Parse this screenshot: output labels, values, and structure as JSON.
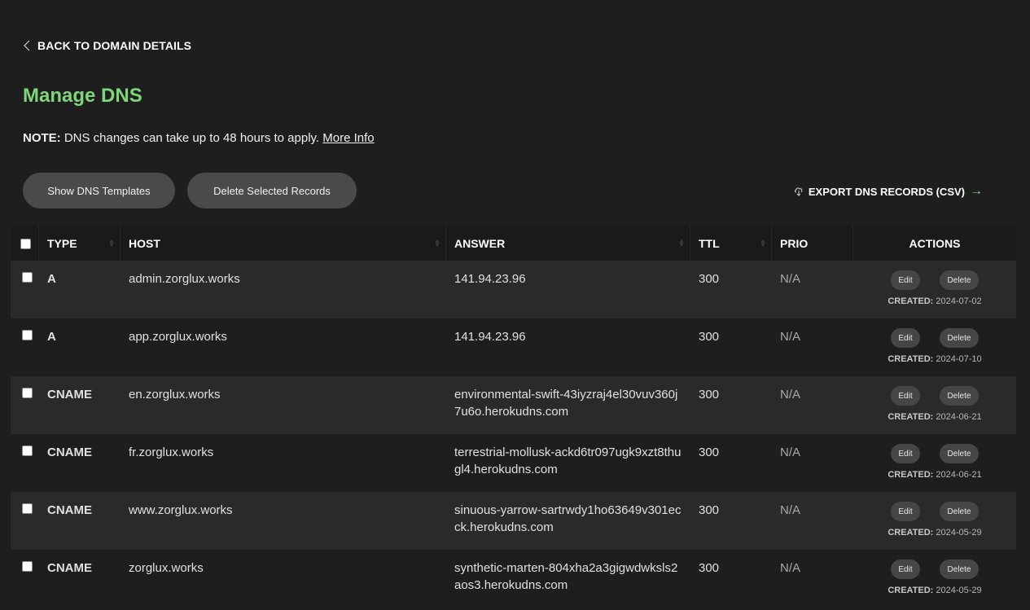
{
  "nav": {
    "back_label": "BACK TO DOMAIN DETAILS"
  },
  "page": {
    "title": "Manage DNS"
  },
  "note": {
    "label": "NOTE:",
    "text": "DNS changes can take up to 48 hours to apply.",
    "link": "More Info"
  },
  "toolbar": {
    "show_templates": "Show DNS Templates",
    "delete_selected": "Delete Selected Records",
    "export": "EXPORT DNS RECORDS (CSV)"
  },
  "table": {
    "columns": {
      "type": "TYPE",
      "host": "HOST",
      "answer": "ANSWER",
      "ttl": "TTL",
      "prio": "PRIO",
      "actions": "ACTIONS"
    },
    "edit_label": "Edit",
    "delete_label": "Delete",
    "created_label": "CREATED:",
    "rows": [
      {
        "type": "A",
        "host": "admin.zorglux.works",
        "answer": "141.94.23.96",
        "ttl": "300",
        "prio": "N/A",
        "created": "2024-07-02"
      },
      {
        "type": "A",
        "host": "app.zorglux.works",
        "answer": "141.94.23.96",
        "ttl": "300",
        "prio": "N/A",
        "created": "2024-07-10"
      },
      {
        "type": "CNAME",
        "host": "en.zorglux.works",
        "answer": "environmental-swift-43iyzraj4el30vuv360j7u6o.herokudns.com",
        "ttl": "300",
        "prio": "N/A",
        "created": "2024-06-21"
      },
      {
        "type": "CNAME",
        "host": "fr.zorglux.works",
        "answer": "terrestrial-mollusk-ackd6tr097ugk9xzt8thugl4.herokudns.com",
        "ttl": "300",
        "prio": "N/A",
        "created": "2024-06-21"
      },
      {
        "type": "CNAME",
        "host": "www.zorglux.works",
        "answer": "sinuous-yarrow-sartrwdy1ho63649v301ecck.herokudns.com",
        "ttl": "300",
        "prio": "N/A",
        "created": "2024-05-29"
      },
      {
        "type": "CNAME",
        "host": "zorglux.works",
        "answer": "synthetic-marten-804xha2a3gigwdwksls2aos3.herokudns.com",
        "ttl": "300",
        "prio": "N/A",
        "created": "2024-05-29"
      }
    ]
  },
  "colors": {
    "accent": "#7fd67a",
    "background": "#1e1e1e",
    "row_alt": "#2a2a2a",
    "button": "#4a4a4a"
  },
  "icons": {
    "back": "chevron-left-icon",
    "export": "download-cloud-icon",
    "export_arrow": "arrow-right-icon"
  }
}
